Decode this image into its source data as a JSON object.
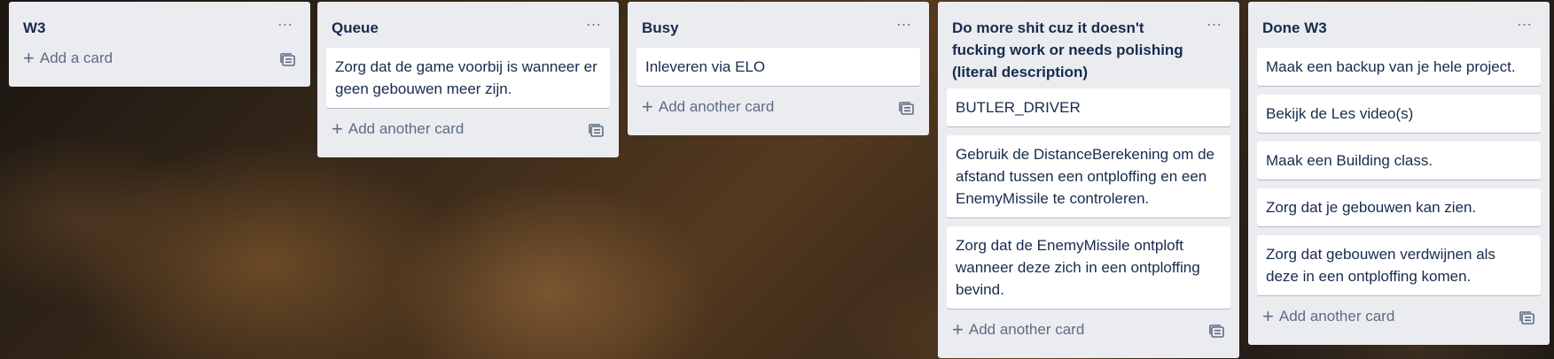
{
  "lists": [
    {
      "title": "W3",
      "menu": "…",
      "cards": [],
      "add_label": "Add a card",
      "template_icon": "card-template-icon"
    },
    {
      "title": "Queue",
      "menu": "…",
      "cards": [
        "Zorg dat de game voorbij is wanneer er geen gebouwen meer zijn."
      ],
      "add_label": "Add another card",
      "template_icon": "card-template-icon"
    },
    {
      "title": "Busy",
      "menu": "…",
      "cards": [
        "Inleveren via ELO"
      ],
      "add_label": "Add another card",
      "template_icon": "card-template-icon"
    },
    {
      "title": "Do more shit cuz it doesn't fucking work or needs polishing (literal description)",
      "menu": "…",
      "cards": [
        "BUTLER_DRIVER",
        "Gebruik de DistanceBerekening om de afstand tussen een ontploffing en een EnemyMissile te controleren.",
        "Zorg dat de EnemyMissile ontploft wanneer deze zich in een ontploffing bevind."
      ],
      "add_label": "Add another card",
      "template_icon": "card-template-icon"
    },
    {
      "title": "Done W3",
      "menu": "…",
      "cards": [
        "Maak een backup van je hele project.",
        "Bekijk de Les video(s)",
        "Maak een Building class.",
        "Zorg dat je gebouwen kan zien.",
        "Zorg dat gebouwen verdwijnen als deze in een ontploffing komen."
      ],
      "add_label": "Add another card",
      "template_icon": "card-template-icon"
    }
  ],
  "colors": {
    "list_bg": "#ebecf0",
    "card_bg": "#ffffff",
    "text": "#172b4d",
    "muted": "#5e6c84"
  }
}
